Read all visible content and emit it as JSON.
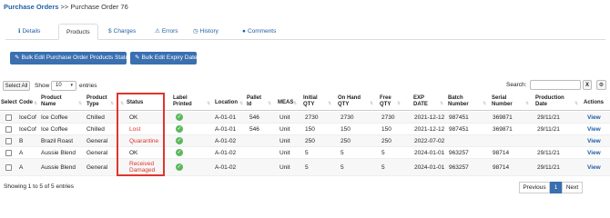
{
  "breadcrumb": {
    "parent": "Purchase Orders",
    "sep": ">>",
    "current": "Purchase Order 76"
  },
  "tabs": [
    {
      "label": "Details",
      "icon": "info-icon"
    },
    {
      "label": "Products",
      "icon": "",
      "active": true
    },
    {
      "label": "Charges",
      "icon": "dollar-icon"
    },
    {
      "label": "Errors",
      "icon": "warning-icon"
    },
    {
      "label": "History",
      "icon": "clock-icon"
    },
    {
      "label": "Comments",
      "icon": "comment-icon"
    }
  ],
  "actions": {
    "bulk_status": "Bulk Edit Purchase Order Products Statuses",
    "bulk_expiry": "Bulk Edit Expiry Dates"
  },
  "controls": {
    "select_all": "Select All",
    "show": "Show",
    "entries_value": "10",
    "entries_label": "entries",
    "search_label": "Search:",
    "clear": "X"
  },
  "columns": {
    "select": "Select",
    "code": "Code",
    "product_name": [
      "Product",
      "Name"
    ],
    "product_type": [
      "Product",
      "Type"
    ],
    "status": "Status",
    "label_printed": [
      "Label",
      "Printed"
    ],
    "location": "Location",
    "pallet_id": [
      "Pallet",
      "Id"
    ],
    "meas": "MEAS",
    "initial_qty": [
      "Initial",
      "QTY"
    ],
    "on_hand_qty": [
      "On Hand",
      "QTY"
    ],
    "free_qty": [
      "Free",
      "QTY"
    ],
    "exp_date": [
      "EXP",
      "DATE"
    ],
    "batch_number": [
      "Batch",
      "Number"
    ],
    "serial_number": [
      "Serial",
      "Number"
    ],
    "production_date": [
      "Production",
      "Date"
    ],
    "actions": "Actions"
  },
  "rows": [
    {
      "code": "IceCof",
      "name": "Ice Coffee",
      "type": "Chilled",
      "status": "OK",
      "status_red": false,
      "location": "A-01-01",
      "pallet": "546",
      "meas": "Unit",
      "initial": "2730",
      "on_hand": "2730",
      "free": "2730",
      "exp": "2021-12-12",
      "batch": "987451",
      "serial": "369871",
      "prod": "29/11/21",
      "action": "View"
    },
    {
      "code": "IceCof",
      "name": "Ice Coffee",
      "type": "Chilled",
      "status": "Lost",
      "status_red": true,
      "location": "A-01-01",
      "pallet": "546",
      "meas": "Unit",
      "initial": "150",
      "on_hand": "150",
      "free": "150",
      "exp": "2021-12-12",
      "batch": "987451",
      "serial": "369871",
      "prod": "29/11/21",
      "action": "View"
    },
    {
      "code": "B",
      "name": "Brazil Roast",
      "type": "General",
      "status": "Quarantine",
      "status_red": true,
      "location": "A-01-02",
      "pallet": "",
      "meas": "Unit",
      "initial": "250",
      "on_hand": "250",
      "free": "250",
      "exp": "2022-07-02",
      "batch": "",
      "serial": "",
      "prod": "",
      "action": "View"
    },
    {
      "code": "A",
      "name": "Aussie Blend",
      "type": "General",
      "status": "OK",
      "status_red": false,
      "location": "A-01-02",
      "pallet": "",
      "meas": "Unit",
      "initial": "5",
      "on_hand": "5",
      "free": "5",
      "exp": "2024-01-01",
      "batch": "963257",
      "serial": "98714",
      "prod": "29/11/21",
      "action": "View"
    },
    {
      "code": "A",
      "name": "Aussie Blend",
      "type": "General",
      "status": "Received Damaged",
      "status_red": true,
      "location": "A-01-02",
      "pallet": "",
      "meas": "Unit",
      "initial": "5",
      "on_hand": "5",
      "free": "5",
      "exp": "2024-01-01",
      "batch": "963257",
      "serial": "98714",
      "prod": "29/11/21",
      "action": "View"
    }
  ],
  "footer": {
    "info": "Showing 1 to 5 of 5 entries",
    "previous": "Previous",
    "page": "1",
    "next": "Next"
  },
  "colors": {
    "accent": "#3a6fb0",
    "link": "#1f5fa6",
    "alert": "#e0352b",
    "ok": "#5cb85c"
  }
}
